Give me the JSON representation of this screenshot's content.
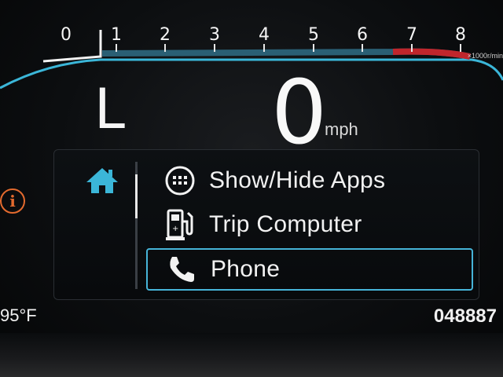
{
  "tachometer": {
    "ticks": [
      "0",
      "1",
      "2",
      "3",
      "4",
      "5",
      "6",
      "7",
      "8"
    ],
    "unit": "×1000r/min",
    "accent_color": "#3bb6d8",
    "redline_color": "#c0262c"
  },
  "gear": {
    "label": "L"
  },
  "speed": {
    "value": "0",
    "unit": "mph"
  },
  "menu": {
    "items": [
      {
        "label": "Show/Hide Apps",
        "icon": "apps-grid-icon"
      },
      {
        "label": "Trip Computer",
        "icon": "fuel-pump-icon"
      },
      {
        "label": "Phone",
        "icon": "phone-icon",
        "selected": true
      }
    ],
    "home_icon": "home-icon",
    "highlight_color": "#46b4d8"
  },
  "warning": {
    "icon": "info-icon",
    "symbol": "i",
    "color": "#e36a2e"
  },
  "status": {
    "outside_temp": "95°F",
    "odometer": "048887"
  }
}
